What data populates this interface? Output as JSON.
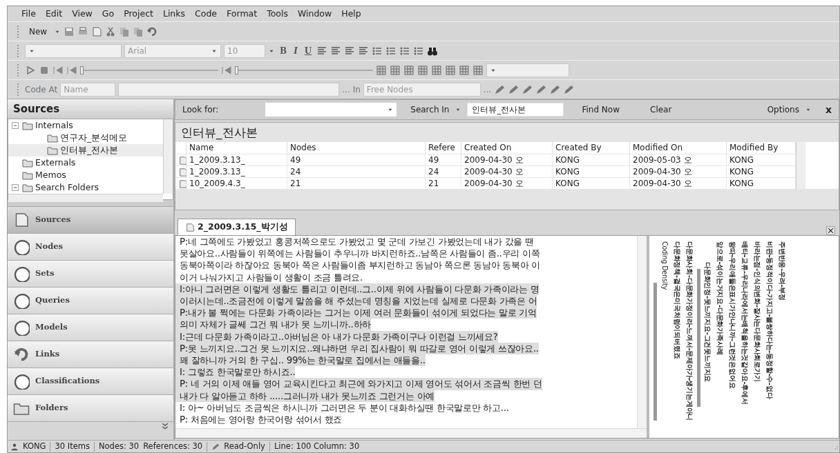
{
  "menu": [
    "File",
    "Edit",
    "View",
    "Go",
    "Project",
    "Links",
    "Code",
    "Format",
    "Tools",
    "Window",
    "Help"
  ],
  "toolbar_standard": {
    "new_button": "New"
  },
  "toolbar_format": {
    "font_field": "Arial",
    "size_field": "10",
    "bold": "B",
    "italic": "I",
    "underline": "U"
  },
  "media_toolbar": {
    "volume_slider": {
      "level": 0
    },
    "speed_slider": {
      "level": 0
    }
  },
  "toolbar_coding": {
    "code_at_label": "Code At",
    "code_at_field": "Name",
    "browse_1": "...",
    "in_label": "In",
    "in_field": "Free Nodes",
    "browse_2": "..."
  },
  "navigation": {
    "title": "Sources",
    "tree": [
      {
        "label": "Internals",
        "expanded": true,
        "selected": false,
        "children": [
          {
            "label": "연구자_분석메모",
            "selected": false
          },
          {
            "label": "인터뷰_전사본",
            "selected": true
          }
        ]
      },
      {
        "label": "Externals",
        "selected": false
      },
      {
        "label": "Memos",
        "selected": false
      },
      {
        "label": "Search Folders",
        "expanded": true,
        "selected": false
      }
    ],
    "buttons": [
      {
        "label": "Sources",
        "selected": true
      },
      {
        "label": "Nodes",
        "selected": false
      },
      {
        "label": "Sets",
        "selected": false
      },
      {
        "label": "Queries",
        "selected": false
      },
      {
        "label": "Models",
        "selected": false
      },
      {
        "label": "Links",
        "selected": false
      },
      {
        "label": "Classifications",
        "selected": false
      },
      {
        "label": "Folders",
        "selected": false
      }
    ]
  },
  "find_bar": {
    "look_for_label": "Look for:",
    "search_in_button": "Search In",
    "search_in_value": "인터뷰_전사본",
    "find_now": "Find Now",
    "clear": "Clear",
    "options": "Options",
    "close": "x"
  },
  "list_view": {
    "title": "인터뷰_전사본",
    "columns": [
      "Name",
      "Nodes",
      "Refere",
      "Created On",
      "Created By",
      "Modified On",
      "Modified By"
    ],
    "rows": [
      [
        "1_2009.3.13_",
        "49",
        "49",
        "2009-04-30 오",
        "KONG",
        "2009-05-03 오",
        "KONG"
      ],
      [
        "1_2009.3.13_",
        "24",
        "24",
        "2009-04-30 오",
        "KONG",
        "2009-04-30 오",
        "KONG"
      ],
      [
        "10_2009.4.3_",
        "21",
        "21",
        "2009-04-30 오",
        "KONG",
        "2009-04-30 오",
        "KONG"
      ]
    ]
  },
  "document": {
    "tab": "2_2009.3.15_박기성",
    "lines": [
      {
        "text": "P:네 그쪽에도 가봤었고 홍콩저쪽으로도 가봤었고 몇 군데 가보긴 가봤었는데 내가 갔을 땐",
        "highlighted": false
      },
      {
        "text": "못살아요..사람들이 위쪽에는 사람들이 추우니까 바지런하죠..남쪽은 사람들이 좀..우리 이쪽",
        "highlighted": false
      },
      {
        "text": "동북아쪽이라 하잖아요 동북아 쪽은 사람들이좀 부지런하고 동남아 쪽으론 동남아 동북아 이",
        "highlighted": false
      },
      {
        "text": "이거 나눠가지고 사람들이 생활이 조금 틀려요.",
        "highlighted": false
      },
      {
        "text": "I:아니 그러면은 이렇게 생활도 틀리고 이런데..그..이제 위에 사람들이 다문화 가족이라는 명",
        "highlighted": true
      },
      {
        "text": "이러시는데..조금전에 이렇게 말씀을 해 주셨는데 명칭을 지었는데 실제로 다문화 가족은 어",
        "highlighted": true
      },
      {
        "text": "P:내가 볼 쩍에는 다문화 가족이라는 그거는 이제 여러 문화들이 섞이게 되었다는 말로 기억",
        "highlighted": true
      },
      {
        "text": "의미 자체가 글쎄 그건 뭐 내가 못 느끼니까..하하",
        "highlighted": true
      },
      {
        "text": "I:근데 다문화 가족이라고..아버님은 아 내가 다문화 가족이구나 이런걸 느끼세요?",
        "highlighted": true
      },
      {
        "text": "P:못 느끼지요..그건 못 느끼지요..왜냐하면 우리 집사람이 뭐 따갈로 영어 이렇게 쓰잖아요..",
        "highlighted": true
      },
      {
        "text": "꽤 잘하니까 거의 한 구십.. 99%는 한국말로 집에서는 애들을..",
        "highlighted": true
      },
      {
        "text": "I: 그렇죠 한국말로만 하시죠..",
        "highlighted": true
      },
      {
        "text": "P: 네 거의 이제 애들 영어 교육시킨다고 최근에 와가지고 이제 영어도 섞어서 조금씩 한번 던",
        "highlighted": true
      },
      {
        "text": "내가 다 알아듣고 하하 .....그러니까 내가 못느끼죠 그런거는 아예",
        "highlighted": true
      },
      {
        "text": "I: 아~ 아버님도 조금씩은 하시니까 그러면은 두 분이 대화하실땐 한국말로만 하고...",
        "highlighted": false
      },
      {
        "text": "P: 처음에는 영어랑 한국어랑 섞어서 했죠",
        "highlighted": false
      }
    ]
  },
  "coding_stripes": {
    "density_label": "Coding Density",
    "stripes": [
      {
        "label": "다문화정책-결국은미국처럼이되버렸죠",
        "offset": false
      },
      {
        "label": "다문화사회-다문화가정이라-느껴서-문제아가-생기는게아니",
        "offset": false
      },
      {
        "label": "다문화인정-못느끼지요-그건못느끼지요",
        "offset": true
      },
      {
        "label": "앞으로-섞이는거지요-다문화가족사례",
        "offset": false
      },
      {
        "label": "왕따-우리애들은표시가안나니까-그런것은없어요",
        "offset": false
      },
      {
        "label": "배타-교류-우리나라에서는배척을하는것같아요-후에서",
        "offset": false
      },
      {
        "label": "바라는점-인식의변화-잘사는다문화사회로가기",
        "offset": false
      },
      {
        "label": "비판-동정적이다-가지고-불쌍하다는-동정할-수-없다",
        "offset": false
      },
      {
        "label": "주변반응-우려-부정",
        "offset": false
      }
    ]
  },
  "status_bar": {
    "user": "KONG",
    "items": "30 Items",
    "nodes": "Nodes: 30",
    "references": "References: 30",
    "mode": "Read-Only",
    "position": "Line: 100 Column: 30"
  }
}
